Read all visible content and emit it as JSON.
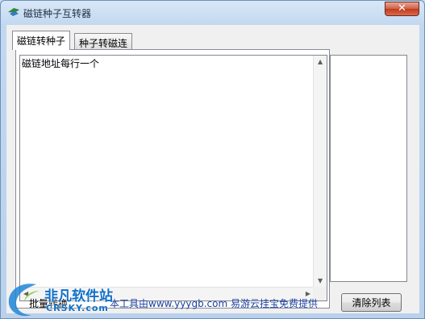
{
  "window": {
    "title": "磁链种子互转器",
    "close_label": "✕"
  },
  "tabs": [
    {
      "label": "磁链转种子",
      "active": true
    },
    {
      "label": "种子转磁连",
      "active": false
    }
  ],
  "magnet_input": {
    "value": "磁链地址每行一个"
  },
  "footer": {
    "batch_label": "批量转换",
    "credit": "本工具由www.yyygb.com 易游云挂宝免费提供",
    "clear_button": "清除列表"
  },
  "watermark": {
    "title": "非凡软件站",
    "subtitle": "CRSKY.com"
  },
  "colors": {
    "accent": "#1170c8",
    "credit_text": "#1a3fa0",
    "close": "#c1391c"
  }
}
